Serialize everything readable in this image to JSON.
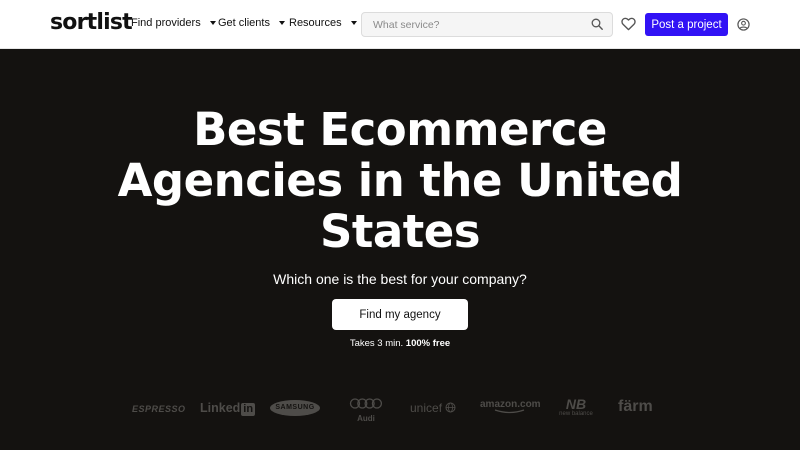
{
  "header": {
    "logo": "sortlist",
    "nav": [
      {
        "label": "Find providers"
      },
      {
        "label": "Get clients"
      },
      {
        "label": "Resources"
      }
    ],
    "search_placeholder": "What service?",
    "post_button": "Post a project",
    "icons": [
      "search-icon",
      "heart-icon",
      "user-icon"
    ]
  },
  "hero": {
    "title_lines": [
      "Best Ecommerce",
      "Agencies in the United",
      "States"
    ],
    "subtitle": "Which one is the best for your company?",
    "cta": "Find my agency",
    "note_prefix": "Takes 3 min.",
    "note_bold": "100% free"
  },
  "logos": [
    "ESPRESSO",
    "Linked",
    "in",
    "SAMSUNG",
    "Audi",
    "unicef",
    "amazon.com",
    "new balance",
    "färm"
  ],
  "colors": {
    "hero_background": "#141210",
    "primary": "#3112f5",
    "logo_gray": "#4e4c49"
  }
}
